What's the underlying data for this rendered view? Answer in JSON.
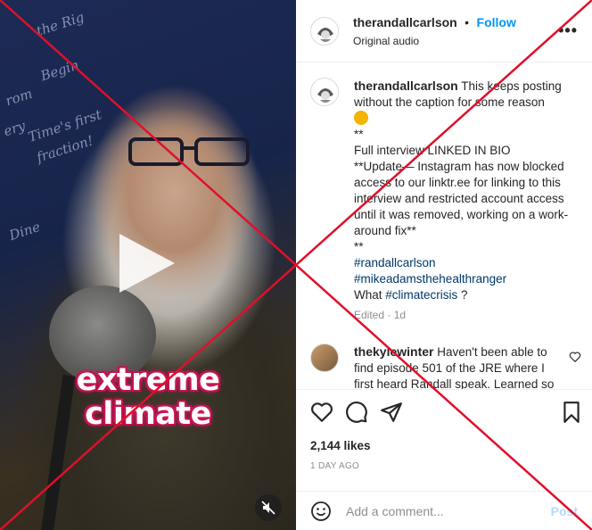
{
  "video": {
    "overlay_line1": "extreme",
    "overlay_line2": "climate",
    "board_text": [
      "the Rig",
      "Begin",
      "rom",
      "ery",
      "Time's first",
      "fraction!",
      "Dine"
    ]
  },
  "post": {
    "author": "therandallcarlson",
    "separator": "•",
    "follow_label": "Follow",
    "audio_label": "Original audio",
    "more_label": "•••",
    "caption": {
      "username": "therandallcarlson",
      "line1": "This keeps posting without the caption for some reason",
      "stars1": "**",
      "line2": "Full interview LINKED IN BIO",
      "line3": "**Update— Instagram has now blocked access to our linktr.ee for linking to this interview and restricted account access until it was removed, working on a work-around fix**",
      "stars2": "**",
      "tag1": "#randallcarlson",
      "tag2": "#mikeadamsthehealthranger",
      "question_prefix": "What ",
      "tag3": "#climatecrisis",
      "question_suffix": " ?",
      "meta": "Edited · 1d"
    },
    "comment": {
      "username": "thekylewinter",
      "text": "Haven't been able to find episode 501 of the JRE where I first heard Randall speak. Learned so"
    },
    "likes": "2,144 likes",
    "date": "1 DAY AGO",
    "comment_placeholder": "Add a comment...",
    "post_label": "Post"
  },
  "colors": {
    "accent": "#0095f6",
    "x_overlay": "#e0102a",
    "overlay_glow": "#d2185a"
  }
}
